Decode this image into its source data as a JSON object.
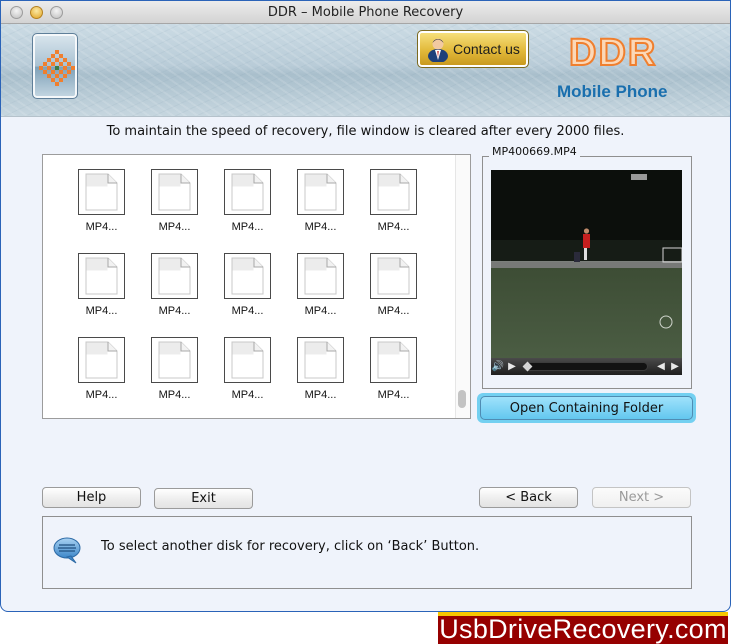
{
  "window": {
    "title": "DDR – Mobile Phone Recovery"
  },
  "header": {
    "contact_label": "Contact us",
    "brand_name": "DDR",
    "brand_subtitle": "Mobile Phone"
  },
  "info_message": "To maintain the speed of recovery, file window is cleared after every 2000 files.",
  "files": [
    {
      "label": "MP4...",
      "icon": "generic-file-icon"
    },
    {
      "label": "MP4...",
      "icon": "generic-file-icon"
    },
    {
      "label": "MP4...",
      "icon": "generic-file-icon"
    },
    {
      "label": "MP4...",
      "icon": "generic-file-icon"
    },
    {
      "label": "MP4...",
      "icon": "generic-file-icon"
    },
    {
      "label": "MP4...",
      "icon": "generic-file-icon"
    },
    {
      "label": "MP4...",
      "icon": "generic-file-icon"
    },
    {
      "label": "MP4...",
      "icon": "generic-file-icon"
    },
    {
      "label": "MP4...",
      "icon": "generic-file-icon"
    },
    {
      "label": "MP4...",
      "icon": "generic-file-icon"
    },
    {
      "label": "MP4...",
      "icon": "generic-file-icon"
    },
    {
      "label": "MP4...",
      "icon": "generic-file-icon"
    },
    {
      "label": "MP4...",
      "icon": "generic-file-icon"
    },
    {
      "label": "MP4...",
      "icon": "generic-file-icon"
    },
    {
      "label": "MP4...",
      "icon": "generic-file-icon"
    }
  ],
  "file_list_scroll_position": 1.0,
  "preview": {
    "filename": "MP400669.MP4",
    "playback_progress": 0.0,
    "controls": {
      "volume_icon": "speaker-icon",
      "play_icon": "play-icon",
      "step_back_icon": "step-back-icon",
      "step_forward_icon": "step-forward-icon"
    },
    "open_folder_label": "Open Containing Folder"
  },
  "buttons": {
    "help": "Help",
    "exit": "Exit",
    "back": "< Back",
    "next": "Next >"
  },
  "status_message": "To select another disk for recovery, click on ‘Back’ Button.",
  "watermark": "UsbDriveRecovery.com",
  "colors": {
    "brand_orange": "#f07f2e",
    "brand_blue": "#1a6fae",
    "watermark_red": "#960000",
    "watermark_yellow": "#f7c700",
    "highlight_cyan": "#73d0f1"
  }
}
